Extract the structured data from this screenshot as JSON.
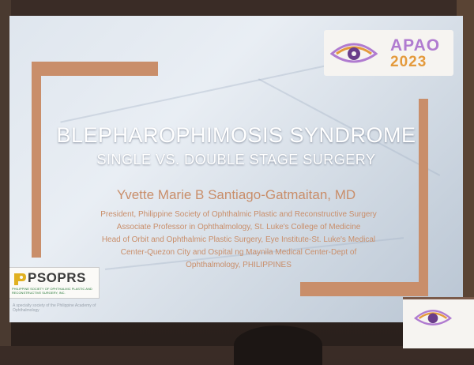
{
  "apao_logo": {
    "word": "APAO",
    "year": "2023"
  },
  "slide": {
    "title": "BLEPHAROPHIMOSIS SYNDROME",
    "subtitle": "SINGLE VS. DOUBLE STAGE SURGERY",
    "author": "Yvette Marie B Santiago-Gatmaitan, MD",
    "affiliations": [
      "President, Philippine Society of Ophthalmic Plastic and Reconstructive Surgery",
      "Associate Professor in Ophthalmology, St. Luke's College of Medicine",
      "Head of Orbit and Ophthalmic Plastic Surgery, Eye Institute-St. Luke's Medical",
      "Center-Quezon City and Ospital ng Maynila Medical Center-Dept of",
      "Ophthalmology, PHILIPPINES"
    ]
  },
  "psoprs_logo": {
    "name": "PSOPRS",
    "subtitle": "PHILIPPINE SOCIETY OF OPHTHALMIC PLASTIC AND RECONSTRUCTIVE SURGERY, INC."
  },
  "footer_text": "A specialty society of the Philippine Academy of Ophthalmology",
  "colors": {
    "accent": "#c98e6a",
    "title": "#ffffff",
    "apao_purple": "#b07bd0",
    "apao_orange": "#e49a3c"
  }
}
